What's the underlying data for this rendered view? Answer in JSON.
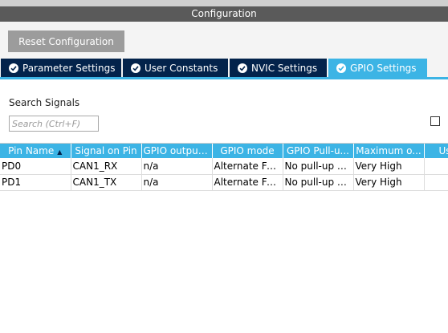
{
  "window": {
    "title": "Configuration"
  },
  "toolbar": {
    "reset_label": "Reset Configuration"
  },
  "tabs": [
    {
      "label": "Parameter Settings",
      "active": false
    },
    {
      "label": "User Constants",
      "active": false
    },
    {
      "label": "NVIC Settings",
      "active": false
    },
    {
      "label": "GPIO Settings",
      "active": true
    }
  ],
  "search": {
    "label": "Search Signals",
    "placeholder": "Search (Ctrl+F)",
    "value": ""
  },
  "table": {
    "columns": [
      "Pin Name",
      "Signal on Pin",
      "GPIO output...",
      "GPIO mode",
      "GPIO Pull-u...",
      "Maximum o...",
      "Us"
    ],
    "sort_icon": "sort-arrow-icon",
    "rows": [
      [
        "PD0",
        "CAN1_RX",
        "n/a",
        "Alternate Fu...",
        "No pull-up a...",
        "Very High",
        ""
      ],
      [
        "PD1",
        "CAN1_TX",
        "n/a",
        "Alternate Fu...",
        "No pull-up a...",
        "Very High",
        ""
      ]
    ]
  },
  "colors": {
    "title_bar": "#5a5a5a",
    "tab_inactive": "#03234b",
    "tab_active": "#3cb4e5",
    "header": "#3cb4e5",
    "button": "#9c9c9c"
  }
}
